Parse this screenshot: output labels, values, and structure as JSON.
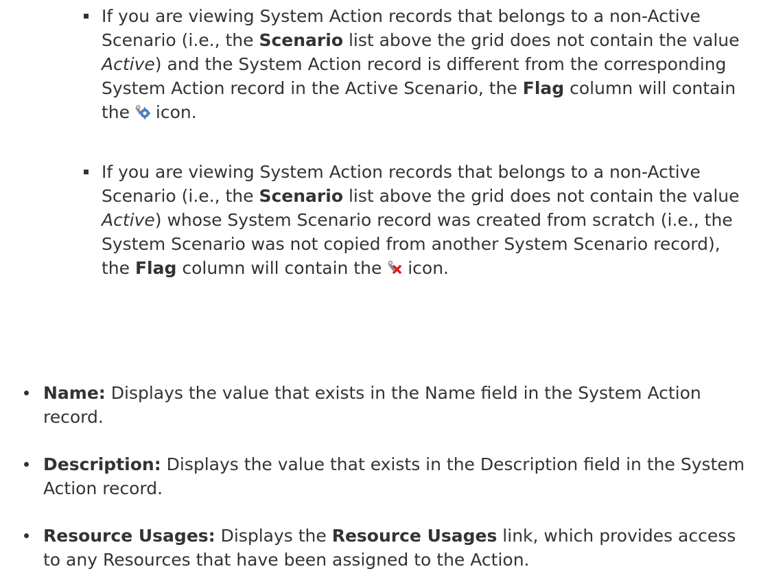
{
  "sub_items": [
    {
      "p1": "If you are viewing System Action records that belongs to a non-Active Scenario (i.e., the ",
      "b1": "Scenario",
      "p2": " list above the grid does not contain the value ",
      "i1": "Active",
      "p3": ") and the System Action record is different from the corresponding System Action record in the Active Scenario, the ",
      "b2": "Flag",
      "p4": " column will contain the ",
      "icon": "gear-modified-icon",
      "p5": " icon."
    },
    {
      "p1": "If you are viewing System Action records that belongs to a non-Active Scenario (i.e., the ",
      "b1": "Scenario",
      "p2": " list above the grid does not contain the value ",
      "i1": "Active",
      "p3": ") whose System Scenario record was created from scratch (i.e., the System Scenario was not copied from another System Scenario record), the ",
      "b2": "Flag",
      "p4": " column will contain the ",
      "icon": "wrench-red-x-icon",
      "p5": " icon."
    }
  ],
  "main_items": [
    {
      "term": "Name:",
      "text": " Displays the value that exists in the Name field in the System Action record."
    },
    {
      "term": "Description:",
      "text": " Displays the value that exists in the Description field in the System Action record."
    },
    {
      "term": "Resource Usages:",
      "text_before": " Displays the ",
      "link": "Resource Usages",
      "text_after": " link, which provides access to any Resources that have been assigned to the Action."
    }
  ],
  "colors": {
    "text": "#333333",
    "icon_gear": "#4a7fc1",
    "icon_wrench": "#8c8c8c",
    "icon_x": "#d42020"
  }
}
